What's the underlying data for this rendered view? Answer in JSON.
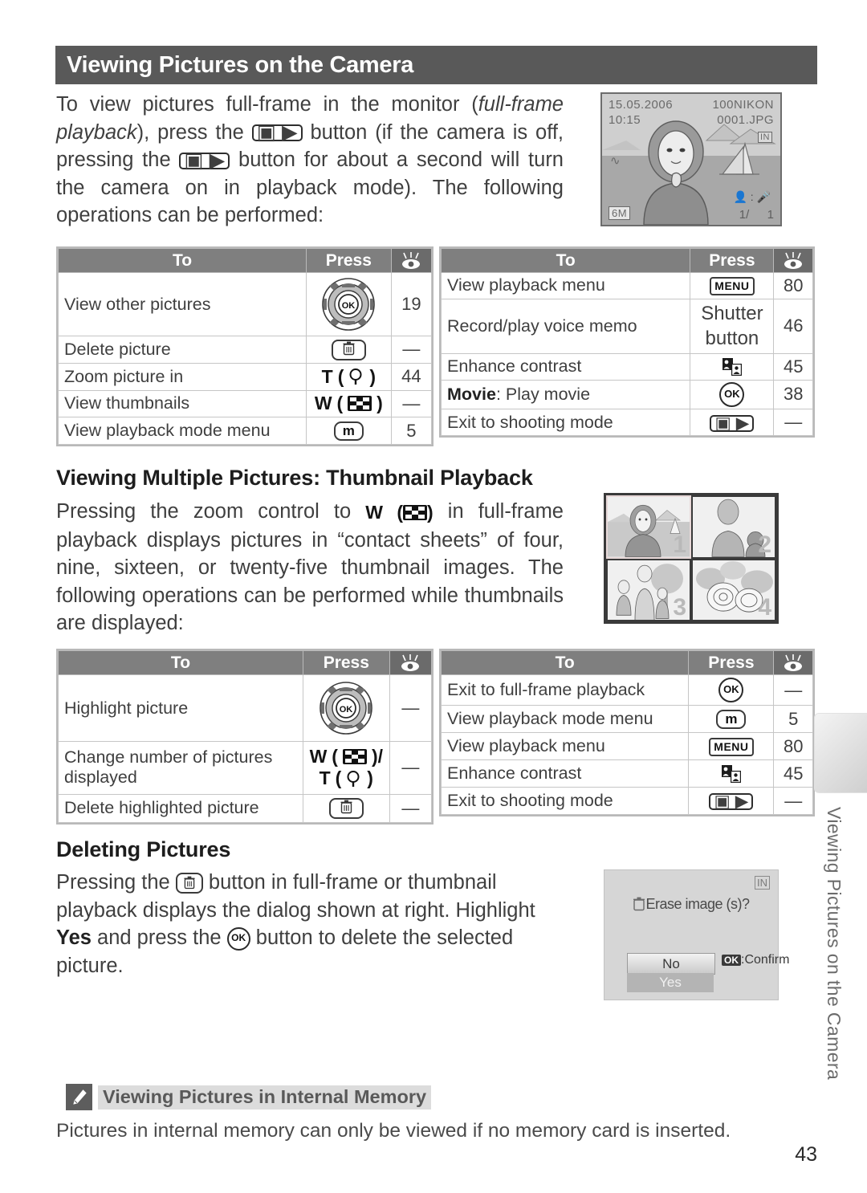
{
  "banner": {
    "title": "Viewing Pictures on the Camera"
  },
  "intro": {
    "part1": "To view pictures full-frame in the monitor (",
    "italic1": "full-frame playback",
    "part2": "), press the ",
    "btn1": "playback-button",
    "part3": " button (if the camera is off, pressing the ",
    "btn2": "playback-button",
    "part4": " button for about a second will turn the camera on in playback mode).  The following operations can be performed:"
  },
  "monitor": {
    "date": "15.05.2006",
    "time": "10:15",
    "folder": "100NIKON",
    "file": "0001.JPG",
    "image_size": "6M",
    "card_icon": "IN",
    "wave_icon": "~",
    "frame_counter_left": "1/",
    "frame_counter_right": "1",
    "voice_icons": ":"
  },
  "tables": {
    "headers": {
      "to": "To",
      "press": "Press",
      "ref": "eye-icon"
    },
    "fullframe_left": {
      "rows": [
        {
          "to": "View other pictures",
          "press": "multi-selector-dial",
          "ref": "19"
        },
        {
          "to": "Delete picture",
          "press": "trash-button",
          "ref": "—"
        },
        {
          "to": "Zoom picture in",
          "press": "T (magnifier)",
          "press_letter": "T",
          "ref": "44"
        },
        {
          "to": "View thumbnails",
          "press": "W (thumbnail)",
          "press_letter": "W",
          "ref": "—"
        },
        {
          "to": "View playback mode menu",
          "press": "m-button",
          "press_letter": "m",
          "ref": "5"
        }
      ]
    },
    "fullframe_right": {
      "rows": [
        {
          "to": "View playback menu",
          "press": "MENU",
          "ref": "80"
        },
        {
          "to": "Record/play voice memo",
          "press": "Shutter button",
          "press_line1": "Shutter",
          "press_line2": "button",
          "ref": "46"
        },
        {
          "to": "Enhance contrast",
          "press": "d-lighting-icon",
          "ref": "45"
        },
        {
          "to_bold": "Movie",
          "to": ": Play movie",
          "press": "OK",
          "ref": "38"
        },
        {
          "to": "Exit to shooting mode",
          "press": "playback-button",
          "ref": "—"
        }
      ]
    },
    "thumb_left": {
      "rows": [
        {
          "to": "Highlight picture",
          "press": "multi-selector-dial",
          "ref": "—"
        },
        {
          "to": "Change number of pictures displayed",
          "press": "W (thumbnail)/ T (magnifier)",
          "press_letter1": "W",
          "press_letter2": "T",
          "ref": "—"
        },
        {
          "to": "Delete highlighted picture",
          "press": "trash-button",
          "ref": "—"
        }
      ]
    },
    "thumb_right": {
      "rows": [
        {
          "to": "Exit to full-frame playback",
          "press": "OK",
          "ref": "—"
        },
        {
          "to": "View playback mode menu",
          "press": "m-button",
          "press_letter": "m",
          "ref": "5"
        },
        {
          "to": "View playback menu",
          "press": "MENU",
          "ref": "80"
        },
        {
          "to": "Enhance contrast",
          "press": "d-lighting-icon",
          "ref": "45"
        },
        {
          "to": "Exit to shooting mode",
          "press": "playback-button",
          "ref": "—"
        }
      ]
    }
  },
  "section_thumbnail": {
    "heading": "Viewing Multiple Pictures: Thumbnail Playback",
    "body_part1": "Pressing the zoom control to ",
    "body_w": "W",
    "body_part2": " in full-frame playback displays pictures in “contact sheets” of four, nine, sixteen, or twenty-five thumbnail images.  The following operations can be performed while thumbnails are displayed:"
  },
  "contact_sheet": {
    "cells": [
      {
        "num": "1",
        "selected": true
      },
      {
        "num": "2",
        "selected": false
      },
      {
        "num": "3",
        "selected": false
      },
      {
        "num": "4",
        "selected": false
      }
    ]
  },
  "section_delete": {
    "heading": "Deleting Pictures",
    "body_part1": "Pressing the ",
    "trash": "trash-button",
    "body_part2": " button in full-frame or thumbnail playback displays the dialog shown at right.  Highlight ",
    "yes_bold": "Yes",
    "body_part3": " and press the ",
    "ok": "OK",
    "body_part4": " button to delete the selected picture."
  },
  "erase_dialog": {
    "card_icon": "IN",
    "message": "Erase image (s)?",
    "no": "No",
    "yes": "Yes",
    "confirm_badge": "OK",
    "confirm_label": ":Confirm"
  },
  "side_tab": {
    "label": "Viewing Pictures on the Camera"
  },
  "note": {
    "icon": "pencil-icon",
    "title": "Viewing Pictures in Internal Memory",
    "body": "Pictures in internal memory can only be viewed if no memory card is inserted."
  },
  "footer": {
    "page_number": "43"
  }
}
